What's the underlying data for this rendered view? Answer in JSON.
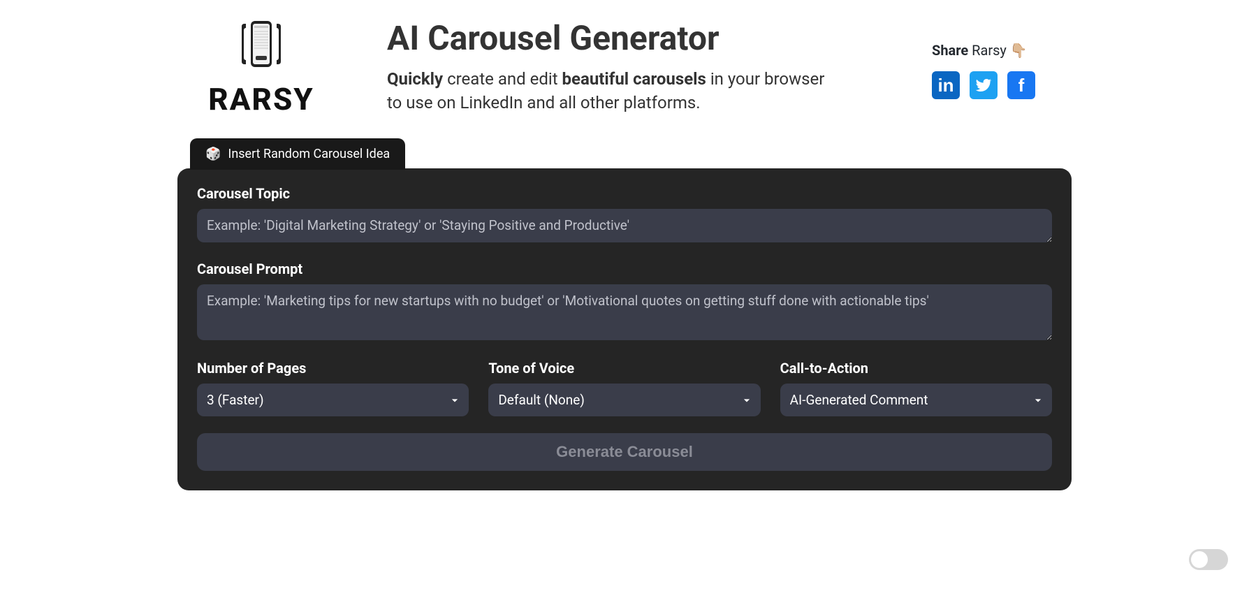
{
  "brand": {
    "name": "RARSY"
  },
  "header": {
    "title": "AI Carousel Generator",
    "sub_bold1": "Quickly",
    "sub_mid1": " create and edit ",
    "sub_bold2": "beautiful carousels",
    "sub_mid2": " in your browser to use on LinkedIn and all other platforms."
  },
  "share": {
    "label_bold": "Share",
    "label_rest": " Rarsy 👇🏼"
  },
  "tab": {
    "dice": "🎲",
    "label": "Insert Random Carousel Idea"
  },
  "form": {
    "topic_label": "Carousel Topic",
    "topic_placeholder": "Example: 'Digital Marketing Strategy' or 'Staying Positive and Productive'",
    "prompt_label": "Carousel Prompt",
    "prompt_placeholder": "Example: 'Marketing tips for new startups with no budget' or 'Motivational quotes on getting stuff done with actionable tips'",
    "pages_label": "Number of Pages",
    "pages_value": "3 (Faster)",
    "tone_label": "Tone of Voice",
    "tone_value": "Default (None)",
    "cta_label": "Call-to-Action",
    "cta_value": "AI-Generated Comment",
    "generate": "Generate Carousel"
  }
}
